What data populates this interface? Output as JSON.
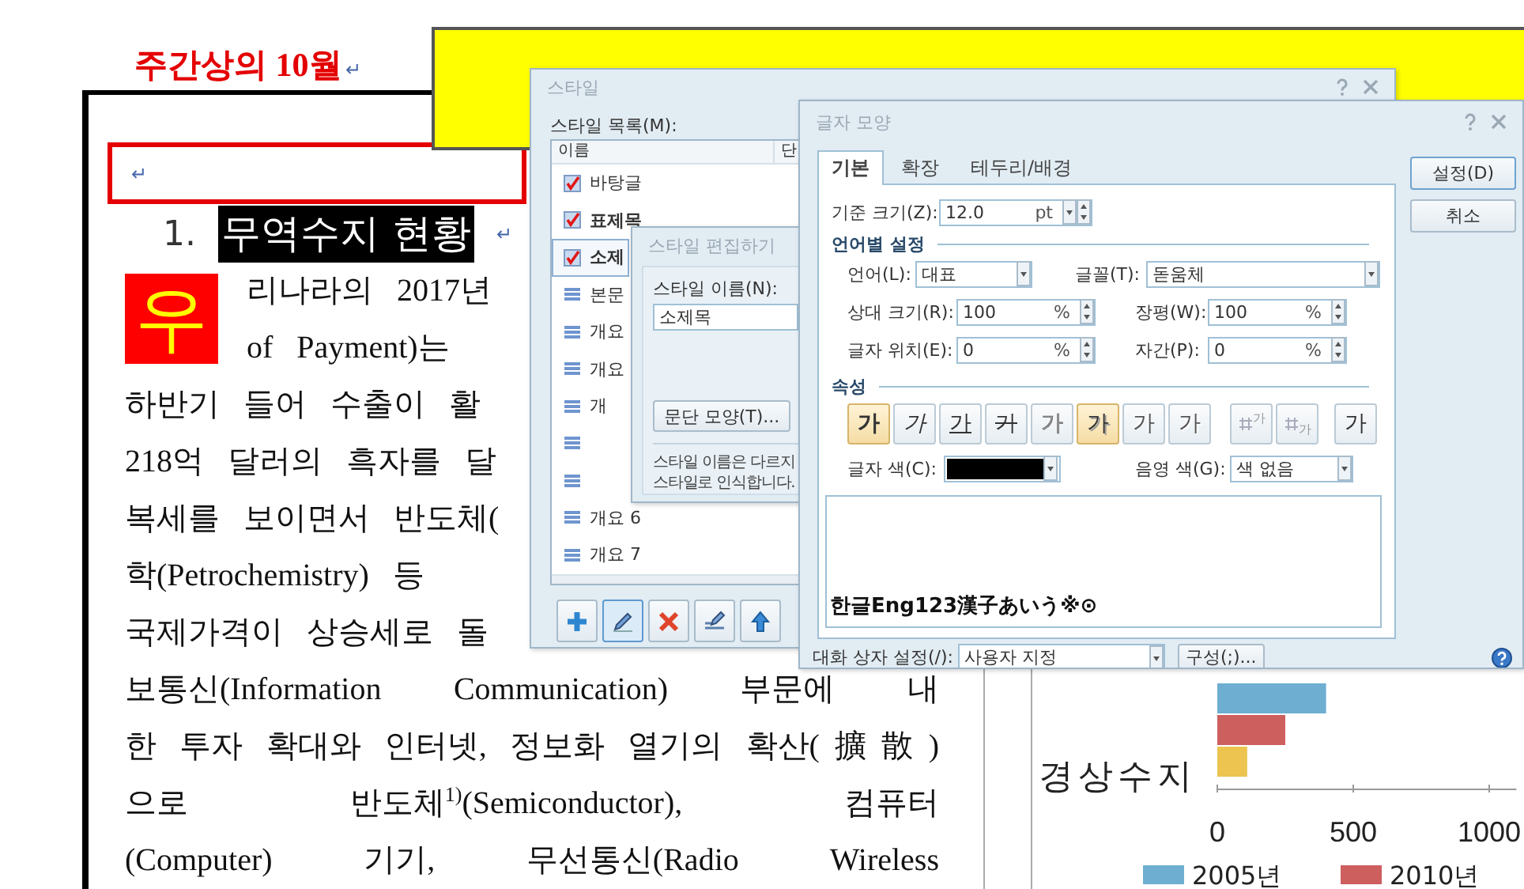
{
  "document": {
    "title": {
      "text": "주간상의 10월",
      "mark": "↵"
    },
    "empty_paragraph": "↵",
    "section": {
      "number": "1.",
      "title": "무역수지 현황",
      "mark": "↵"
    },
    "drop_cap": "우",
    "lines": [
      {
        "text": "리나라의 2017년",
        "kind": "partial"
      },
      {
        "text": "of Payment)는",
        "kind": "partial"
      },
      {
        "text": "하반기 들어 수출이 활",
        "kind": "partial"
      },
      {
        "text": "218억 달러의 흑자를 달",
        "kind": "partial"
      },
      {
        "text": "복세를 보이면서 반도체(",
        "kind": "partial"
      },
      {
        "text": "학(Petrochemistry) 등",
        "kind": "partial"
      },
      {
        "text": "국제가격이 상승세로 돌",
        "kind": "partial"
      },
      {
        "text": "보통신(Information Communication) 부문에 내",
        "kind": "full"
      },
      {
        "text": "한 투자 확대와 인터넷, 정보화 열기의 확산(擴散)",
        "kind": "full"
      },
      {
        "text": "으로 반도체$^{1)}$(Semiconductor), 컴퓨터",
        "kind": "full"
      },
      {
        "text": "(Computer) 기기, 무선통신(Radio Wireless",
        "kind": "full"
      }
    ]
  },
  "chart": {
    "chart_data": {
      "type": "bar",
      "orientation": "horizontal",
      "categories": [
        "경상수지"
      ],
      "series": [
        {
          "name": "2005년",
          "color": "#6eaed1",
          "values": [
            400
          ]
        },
        {
          "name": "2010년",
          "color": "#cd5f5f",
          "values": [
            250
          ]
        },
        {
          "color": "#ecc44f",
          "values": [
            110
          ]
        }
      ],
      "xticks": [
        0,
        500,
        1000
      ],
      "xlim": [
        0,
        1100
      ],
      "legend": true
    }
  },
  "style_dialog": {
    "title": "스타일",
    "list_label": "스타일 목록(M):",
    "columns": [
      "이름",
      "단"
    ],
    "items": [
      {
        "name": "바탕글",
        "kind": "applied",
        "bold": false,
        "selected": false
      },
      {
        "name": "표제목",
        "kind": "applied",
        "bold": true,
        "selected": false
      },
      {
        "name": "소제",
        "kind": "applied",
        "bold": true,
        "selected": true
      },
      {
        "name": "본문",
        "kind": "plain",
        "bold": false,
        "selected": false
      },
      {
        "name": "개요",
        "kind": "plain",
        "bold": false,
        "selected": false
      },
      {
        "name": "개요",
        "kind": "plain",
        "bold": false,
        "selected": false
      },
      {
        "name": "개",
        "kind": "plain",
        "bold": false,
        "selected": false
      },
      {
        "kind": "plain",
        "selected": false
      },
      {
        "kind": "plain",
        "selected": false
      },
      {
        "name": "개요 6",
        "kind": "plain",
        "bold": false,
        "selected": false
      },
      {
        "name": "개요 7",
        "kind": "plain",
        "bold": false,
        "selected": false
      }
    ],
    "toolbar": [
      {
        "kind": "add",
        "selected": false
      },
      {
        "kind": "edit",
        "selected": true
      },
      {
        "kind": "delete",
        "selected": false
      },
      {
        "kind": "rename",
        "selected": false
      },
      {
        "kind": "up",
        "selected": false
      }
    ]
  },
  "edit_dialog": {
    "title": "스타일 편집하기",
    "name_label": "스타일 이름(N):",
    "name_value": "소제목",
    "paragraph_button": "문단 모양(T)...",
    "note": "스타일 이름은 다르지\n스타일로 인식합니다."
  },
  "font_dialog": {
    "title": "글자 모양",
    "tabs": [
      {
        "label": "기본",
        "selected": true
      },
      {
        "label": "확장",
        "selected": false
      },
      {
        "label": "테두리/배경",
        "selected": false
      }
    ],
    "buttons": [
      "설정(D)",
      "취소"
    ],
    "base_size": {
      "label": "기준 크기(Z):",
      "value": "12.0",
      "unit": "pt"
    },
    "language_section": "언어별 설정",
    "language": {
      "label": "언어(L):",
      "value": "대표"
    },
    "font": {
      "label": "글꼴(T):",
      "value": "돋움체"
    },
    "spin_fields": [
      {
        "label": "상대 크기(R):",
        "value": "100",
        "unit": "%"
      },
      {
        "label": "장평(W):",
        "value": "100",
        "unit": "%"
      },
      {
        "label": "글자 위치(E):",
        "value": "0",
        "unit": "%"
      },
      {
        "label": "자간(P):",
        "value": "0",
        "unit": "%"
      }
    ],
    "attributes_section": "속성",
    "attributes": [
      {
        "kind": "bold",
        "label": "가",
        "on": true
      },
      {
        "kind": "italic",
        "label": "가",
        "on": false
      },
      {
        "kind": "underline",
        "label": "가",
        "on": false
      },
      {
        "kind": "strike",
        "label": "가",
        "on": false
      },
      {
        "kind": "outline",
        "label": "가",
        "on": false
      },
      {
        "kind": "shadow",
        "label": "가",
        "on": true
      },
      {
        "kind": "emboss",
        "label": "가",
        "on": false
      },
      {
        "kind": "engrave",
        "label": "가",
        "on": false
      },
      {
        "kind": "superscript",
        "label": "가",
        "on": false
      },
      {
        "kind": "subscript",
        "label": "가",
        "on": false
      },
      {
        "kind": "normal",
        "label": "가",
        "on": false
      }
    ],
    "text_color": {
      "label": "글자 색(C):",
      "color": "#000000"
    },
    "shade_color": {
      "label": "음영 색(G):",
      "value": "색 없음"
    },
    "preview": "한글Eng123漢子あいう※⊙",
    "dialog_setting": {
      "label": "대화 상자 설정(/):",
      "value": "사용자 지정"
    },
    "config_button": "구성(;)..."
  }
}
